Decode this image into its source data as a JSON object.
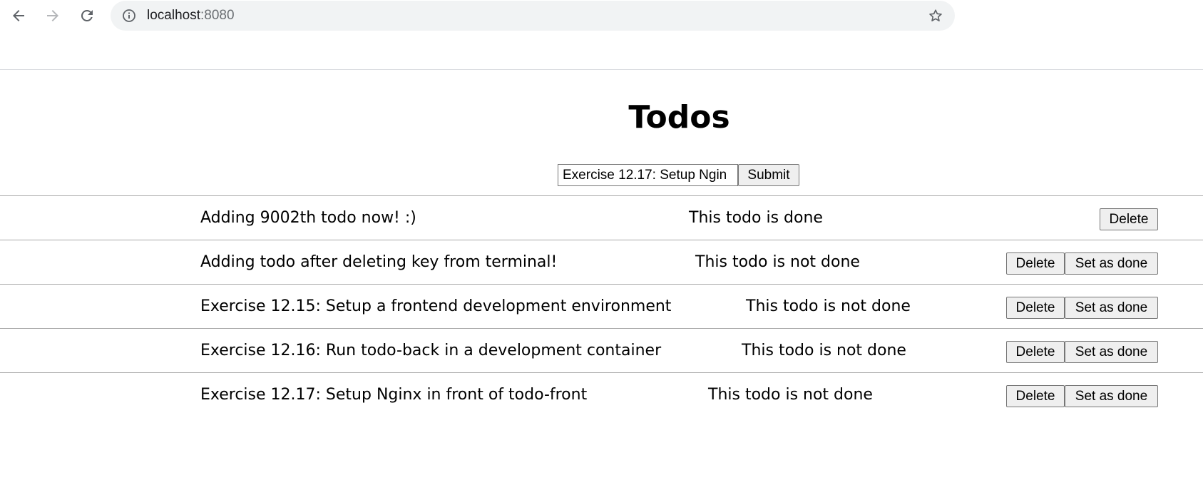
{
  "browser": {
    "url_host": "localhost",
    "url_port": ":8080",
    "icons": {
      "back": "arrow-left-icon",
      "forward": "arrow-right-icon",
      "reload": "reload-icon",
      "site_info": "info-icon",
      "bookmark": "star-icon"
    }
  },
  "page": {
    "title": "Todos",
    "form": {
      "input_value": "Exercise 12.17: Setup Ngin",
      "submit_label": "Submit"
    },
    "delete_label": "Delete",
    "set_done_label": "Set as done",
    "todos": [
      {
        "text": "Adding 9002th todo now! :)",
        "status": "This todo is done",
        "done": true
      },
      {
        "text": "Adding todo after deleting key from terminal!",
        "status": "This todo is not done",
        "done": false
      },
      {
        "text": "Exercise 12.15: Setup a frontend development environment",
        "status": "This todo is not done",
        "done": false
      },
      {
        "text": "Exercise 12.16: Run todo-back in a development container",
        "status": "This todo is not done",
        "done": false
      },
      {
        "text": "Exercise 12.17: Setup Nginx in front of todo-front",
        "status": "This todo is not done",
        "done": false
      }
    ]
  }
}
